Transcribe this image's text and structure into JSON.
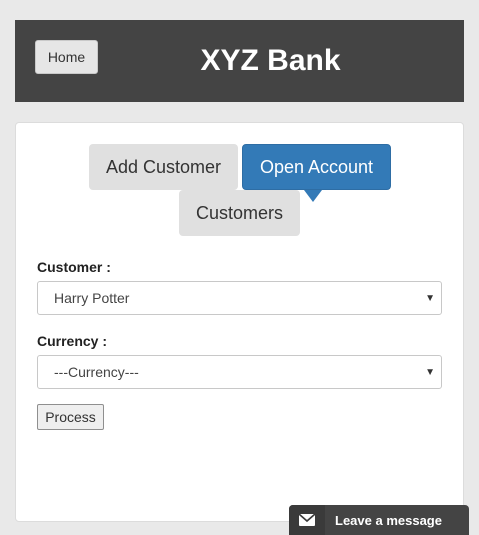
{
  "header": {
    "home_label": "Home",
    "title": "XYZ Bank"
  },
  "tabs": {
    "add_customer": "Add Customer",
    "open_account": "Open Account",
    "customers": "Customers"
  },
  "form": {
    "customer_label": "Customer :",
    "customer_value": "Harry Potter",
    "currency_label": "Currency :",
    "currency_value": "---Currency---",
    "process_label": "Process"
  },
  "chat": {
    "label": "Leave a message",
    "icon": "envelope-icon"
  },
  "colors": {
    "header_bg": "#444444",
    "active_tab": "#337ab7",
    "inactive_tab": "#e0e0e0"
  }
}
